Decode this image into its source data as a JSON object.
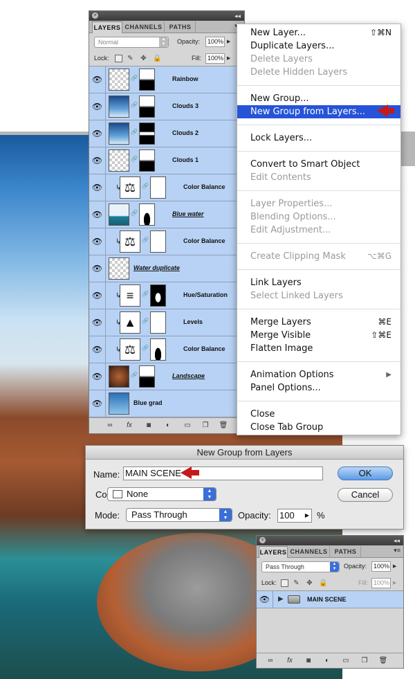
{
  "layers_panel": {
    "tabs": [
      "LAYERS",
      "CHANNELS",
      "PATHS"
    ],
    "blend_mode": "Normal",
    "opacity_label": "Opacity:",
    "opacity_value": "100%",
    "lock_label": "Lock:",
    "fill_label": "Fill:",
    "fill_value": "100%",
    "layers": [
      {
        "name": "Rainbow",
        "thumb": "checker",
        "mask": "topwhite",
        "clip": false,
        "underline": false
      },
      {
        "name": "Clouds 3",
        "thumb": "sky",
        "mask": "topwhite",
        "clip": false,
        "underline": false
      },
      {
        "name": "Clouds 2",
        "thumb": "sky",
        "mask": "bandwhite",
        "clip": false,
        "underline": false
      },
      {
        "name": "Clouds 1",
        "thumb": "checker",
        "mask": "topwhite",
        "clip": false,
        "underline": false
      },
      {
        "name": "Color Balance",
        "thumb": "balance-adj",
        "mask": "white",
        "clip": true,
        "underline": false
      },
      {
        "name": "Blue water",
        "thumb": "water",
        "mask": "bottomblack",
        "clip": false,
        "underline": true
      },
      {
        "name": "Color Balance",
        "thumb": "balance-adj",
        "mask": "white",
        "clip": true,
        "underline": false
      },
      {
        "name": "Water duplicate",
        "thumb": "checker",
        "mask": "none",
        "clip": false,
        "underline": true
      },
      {
        "name": "Hue/Saturation",
        "thumb": "huesat-adj",
        "mask": "blob",
        "clip": true,
        "underline": false
      },
      {
        "name": "Levels",
        "thumb": "levels-adj",
        "mask": "white",
        "clip": true,
        "underline": false
      },
      {
        "name": "Color Balance",
        "thumb": "balance-adj",
        "mask": "bottomblack",
        "clip": true,
        "underline": false
      },
      {
        "name": "Landscape",
        "thumb": "land",
        "mask": "topwhite",
        "clip": false,
        "underline": true
      },
      {
        "name": "Blue grad",
        "thumb": "grad",
        "mask": "none",
        "clip": false,
        "underline": false
      }
    ],
    "bottom_icons": [
      "link-icon",
      "fx-icon",
      "mask-icon",
      "adjustment-icon",
      "folder-icon",
      "new-layer-icon",
      "trash-icon"
    ]
  },
  "context_menu": {
    "items": [
      {
        "label": "New Layer...",
        "shortcut": "⇧⌘N",
        "disabled": false
      },
      {
        "label": "Duplicate Layers...",
        "shortcut": "",
        "disabled": false
      },
      {
        "label": "Delete Layers",
        "shortcut": "",
        "disabled": true
      },
      {
        "label": "Delete Hidden Layers",
        "shortcut": "",
        "disabled": true
      },
      {
        "sep": true
      },
      {
        "label": "New Group...",
        "shortcut": "",
        "disabled": false
      },
      {
        "label": "New Group from Layers...",
        "shortcut": "",
        "disabled": false,
        "highlighted": true
      },
      {
        "sep": true
      },
      {
        "label": "Lock Layers...",
        "shortcut": "",
        "disabled": false
      },
      {
        "sep": true
      },
      {
        "label": "Convert to Smart Object",
        "shortcut": "",
        "disabled": false
      },
      {
        "label": "Edit Contents",
        "shortcut": "",
        "disabled": true
      },
      {
        "sep": true
      },
      {
        "label": "Layer Properties...",
        "shortcut": "",
        "disabled": true
      },
      {
        "label": "Blending Options...",
        "shortcut": "",
        "disabled": true
      },
      {
        "label": "Edit Adjustment...",
        "shortcut": "",
        "disabled": true
      },
      {
        "sep": true
      },
      {
        "label": "Create Clipping Mask",
        "shortcut": "⌥⌘G",
        "disabled": true
      },
      {
        "sep": true
      },
      {
        "label": "Link Layers",
        "shortcut": "",
        "disabled": false
      },
      {
        "label": "Select Linked Layers",
        "shortcut": "",
        "disabled": true
      },
      {
        "sep": true
      },
      {
        "label": "Merge Layers",
        "shortcut": "⌘E",
        "disabled": false
      },
      {
        "label": "Merge Visible",
        "shortcut": "⇧⌘E",
        "disabled": false
      },
      {
        "label": "Flatten Image",
        "shortcut": "",
        "disabled": false
      },
      {
        "sep": true
      },
      {
        "label": "Animation Options",
        "shortcut": "▶",
        "disabled": false
      },
      {
        "label": "Panel Options...",
        "shortcut": "",
        "disabled": false
      },
      {
        "sep": true
      },
      {
        "label": "Close",
        "shortcut": "",
        "disabled": false
      },
      {
        "label": "Close Tab Group",
        "shortcut": "",
        "disabled": false
      }
    ]
  },
  "dialog": {
    "title": "New Group from Layers",
    "name_label": "Name:",
    "name_value": "MAIN SCENE",
    "color_label": "Color:",
    "color_value": "None",
    "mode_label": "Mode:",
    "mode_value": "Pass Through",
    "opacity_label": "Opacity:",
    "opacity_value": "100",
    "opacity_unit": "%",
    "ok_label": "OK",
    "cancel_label": "Cancel"
  },
  "small_panel": {
    "tabs": [
      "LAYERS",
      "CHANNELS",
      "PATHS"
    ],
    "blend_mode": "Pass Through",
    "opacity_label": "Opacity:",
    "opacity_value": "100%",
    "lock_label": "Lock:",
    "fill_label": "Fill:",
    "fill_value": "100%",
    "group_name": "MAIN SCENE"
  },
  "colors": {
    "layer_selected": "#b7d2f4",
    "menu_highlight": "#2753d8",
    "arrow_red": "#c41a1a"
  }
}
